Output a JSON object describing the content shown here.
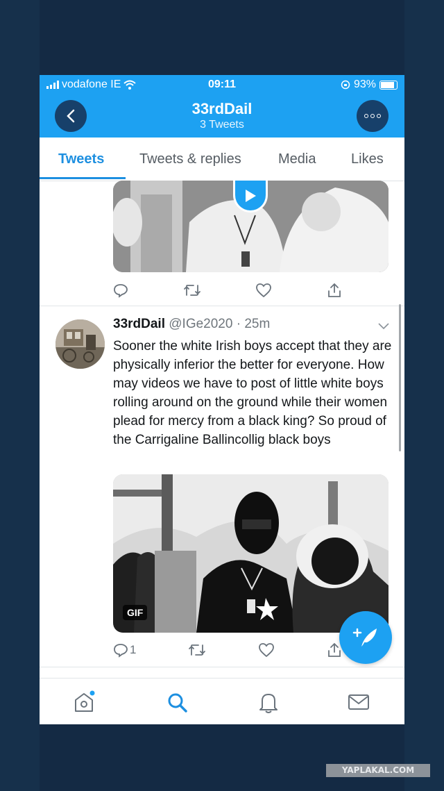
{
  "status_bar": {
    "carrier": "vodafone IE",
    "time": "09:11",
    "battery": "93%"
  },
  "header": {
    "title": "33rdDail",
    "subtitle": "3 Tweets"
  },
  "tabs": [
    {
      "label": "Tweets",
      "active": true
    },
    {
      "label": "Tweets & replies",
      "active": false
    },
    {
      "label": "Media",
      "active": false
    },
    {
      "label": "Likes",
      "active": false
    }
  ],
  "tweet": {
    "display_name": "33rdDail",
    "handle": "@IGe2020",
    "separator": "·",
    "time_ago": "25m",
    "text": "Sooner the white Irish boys accept that they are physically inferior the better for everyone. How may videos we have to post of little white boys rolling around on the ground while their women plead for mercy from a black king? So proud of the Carrigaline Ballincollig black boys",
    "media_badge": "GIF",
    "reply_count": "1"
  },
  "watermark": "YAPLAKAL.COM",
  "colors": {
    "accent": "#1da1f2",
    "frame": "#142a44",
    "active_tab": "#1d8fe0"
  },
  "icons": [
    "wifi-icon",
    "back-arrow-icon",
    "more-icon",
    "play-icon",
    "reply-icon",
    "retweet-icon",
    "like-icon",
    "share-icon",
    "chevron-down-icon",
    "compose-icon",
    "home-icon",
    "search-icon",
    "notifications-icon",
    "messages-icon"
  ]
}
